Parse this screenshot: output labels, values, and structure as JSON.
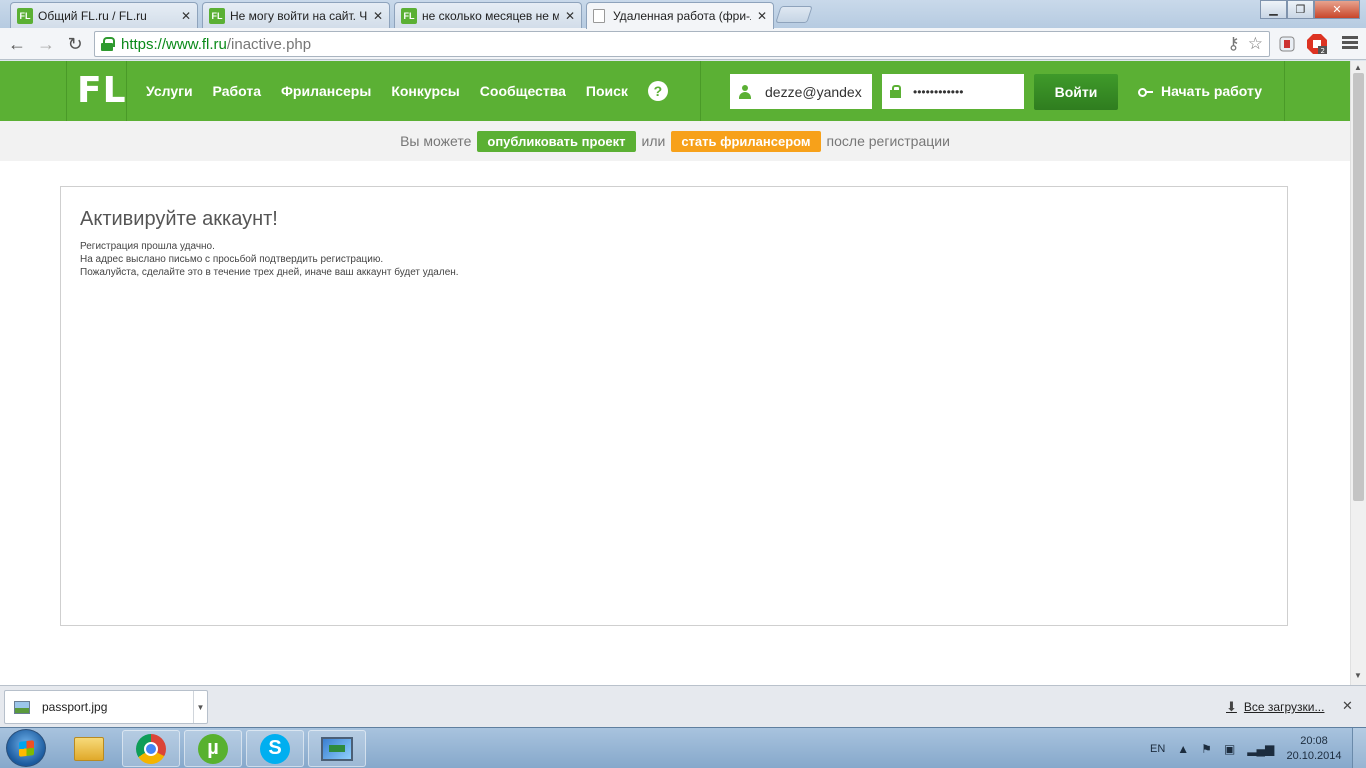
{
  "browser": {
    "tabs": [
      {
        "title": "Общий FL.ru / FL.ru",
        "favicon": "fl-favicon-icon",
        "active": false
      },
      {
        "title": "Не могу войти на сайт. Что",
        "favicon": "fl-favicon-icon",
        "active": false
      },
      {
        "title": "не сколько месяцев не мо",
        "favicon": "fl-favicon-icon",
        "active": false
      },
      {
        "title": "Удаленная работа (фри-л",
        "favicon": "document-icon",
        "active": true
      }
    ],
    "url_scheme": "https://",
    "url_host": "www.fl.ru",
    "url_path": "/inactive.php",
    "extension_badge": "2"
  },
  "site": {
    "logo": "FL",
    "nav": [
      "Услуги",
      "Работа",
      "Фрилансеры",
      "Конкурсы",
      "Сообщества",
      "Поиск"
    ],
    "help_label": "?",
    "login_value": "dezze@yandex",
    "password_value": "••••••••••••",
    "login_button": "Войти",
    "start_link": "Начать работу",
    "colors": {
      "brand_green": "#5bb034",
      "orange": "#f7a11a"
    }
  },
  "promo": {
    "prefix": "Вы можете",
    "publish_btn": "опубликовать проект",
    "or": "или",
    "freelancer_btn": "стать фрилансером",
    "suffix": "после регистрации"
  },
  "content": {
    "title": "Активируйте аккаунт!",
    "lines": [
      "Регистрация прошла удачно.",
      "На адрес выслано письмо с просьбой подтвердить регистрацию.",
      "Пожалуйста, сделайте это в течение трех дней, иначе ваш аккаунт будет удален."
    ]
  },
  "downloads": {
    "file": "passport.jpg",
    "all_label": "Все загрузки..."
  },
  "taskbar": {
    "lang": "EN",
    "time": "20:08",
    "date": "20.10.2014"
  }
}
